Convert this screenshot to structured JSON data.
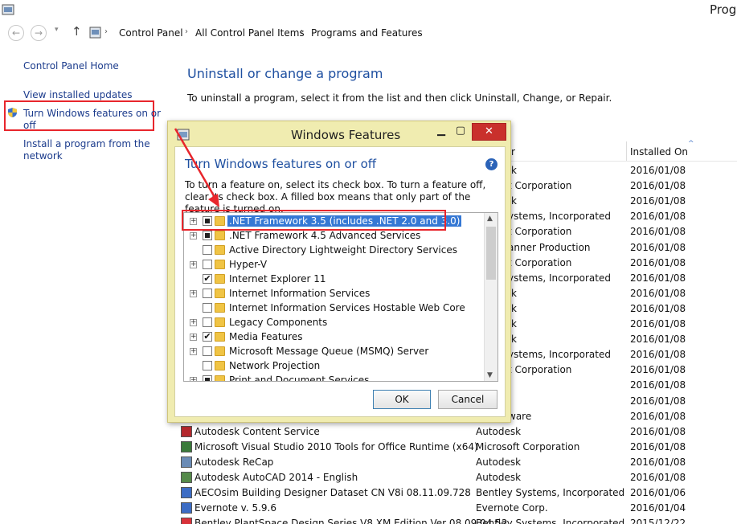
{
  "window": {
    "title": "Progr"
  },
  "address": {
    "crumbs": [
      "Control Panel",
      "All Control Panel Items",
      "Programs and Features"
    ]
  },
  "nav": {
    "back": "←",
    "forward": "→",
    "recent": "▾",
    "up": "↑",
    "sep": "›"
  },
  "sidebar": {
    "home": "Control Panel Home",
    "updates": "View installed updates",
    "features_line1": "Turn Windows features on or",
    "features_line2": "off",
    "install_line1": "Install a program from the",
    "install_line2": "network"
  },
  "main": {
    "title": "Uninstall or change a program",
    "description": "To uninstall a program, select it from the list and then click Uninstall, Change, or Repair.",
    "col_publisher_fragment": "r",
    "col_installed": "Installed On",
    "sort_glyph": "^"
  },
  "programs": [
    {
      "name": "",
      "publisher": "k",
      "date": "2016/01/08"
    },
    {
      "name": "",
      "publisher": "t Corporation",
      "date": "2016/01/08"
    },
    {
      "name": "",
      "publisher": "k",
      "date": "2016/01/08"
    },
    {
      "name": "",
      "publisher": "ystems, Incorporated",
      "date": "2016/01/08"
    },
    {
      "name": "",
      "publisher": "t Corporation",
      "date": "2016/01/08"
    },
    {
      "name": "",
      "publisher": "anner Production",
      "date": "2016/01/08"
    },
    {
      "name": "",
      "publisher": "t Corporation",
      "date": "2016/01/08"
    },
    {
      "name": "",
      "publisher": "ystems, Incorporated",
      "date": "2016/01/08"
    },
    {
      "name": "",
      "publisher": "k",
      "date": "2016/01/08"
    },
    {
      "name": "",
      "publisher": "k",
      "date": "2016/01/08"
    },
    {
      "name": "",
      "publisher": "k",
      "date": "2016/01/08"
    },
    {
      "name": "",
      "publisher": "k",
      "date": "2016/01/08"
    },
    {
      "name": "",
      "publisher": "ystems, Incorporated",
      "date": "2016/01/08"
    },
    {
      "name": "",
      "publisher": "t Corporation",
      "date": "2016/01/08"
    },
    {
      "name": "",
      "publisher": "",
      "date": "2016/01/08"
    },
    {
      "name": "",
      "publisher": "",
      "date": "2016/01/08"
    },
    {
      "name": "",
      "publisher": "ware",
      "date": "2016/01/08"
    },
    {
      "name": "Autodesk Content Service",
      "publisher": "Autodesk",
      "date": "2016/01/08"
    },
    {
      "name": "Microsoft Visual Studio 2010 Tools for Office Runtime (x64)",
      "publisher": "Microsoft Corporation",
      "date": "2016/01/08"
    },
    {
      "name": "Autodesk ReCap",
      "publisher": "Autodesk",
      "date": "2016/01/08"
    },
    {
      "name": "Autodesk AutoCAD 2014 - English",
      "publisher": "Autodesk",
      "date": "2016/01/08"
    },
    {
      "name": "AECOsim Building Designer Dataset CN V8i 08.11.09.728",
      "publisher": "Bentley Systems, Incorporated",
      "date": "2016/01/06"
    },
    {
      "name": "Evernote v. 5.9.6",
      "publisher": "Evernote Corp.",
      "date": "2016/01/04"
    },
    {
      "name": "Bentley PlantSpace Design Series V8 XM Edition Ver 08.09.04.52",
      "publisher": "Bentley Systems, Incorporated",
      "date": "2015/12/22"
    }
  ],
  "dialog": {
    "title": "Windows Features",
    "heading": "Turn Windows features on or off",
    "help": "?",
    "description": "To turn a feature on, select its check box. To turn a feature off, clear its check box. A filled box means that only part of the feature is turned on.",
    "minimize": "▁",
    "maximize": "▢",
    "close": "✕",
    "ok": "OK",
    "cancel": "Cancel",
    "features": [
      {
        "label": ".NET Framework 3.5 (includes .NET 2.0 and 3.0)",
        "expand": "+",
        "check": "partial",
        "selected": true
      },
      {
        "label": ".NET Framework 4.5 Advanced Services",
        "expand": "+",
        "check": "partial"
      },
      {
        "label": "Active Directory Lightweight Directory Services",
        "expand": "",
        "check": ""
      },
      {
        "label": "Hyper-V",
        "expand": "+",
        "check": ""
      },
      {
        "label": "Internet Explorer 11",
        "expand": "",
        "check": "✔"
      },
      {
        "label": "Internet Information Services",
        "expand": "+",
        "check": ""
      },
      {
        "label": "Internet Information Services Hostable Web Core",
        "expand": "",
        "check": ""
      },
      {
        "label": "Legacy Components",
        "expand": "+",
        "check": ""
      },
      {
        "label": "Media Features",
        "expand": "+",
        "check": "✔"
      },
      {
        "label": "Microsoft Message Queue (MSMQ) Server",
        "expand": "+",
        "check": ""
      },
      {
        "label": "Network Projection",
        "expand": "",
        "check": ""
      },
      {
        "label": "Print and Document Services",
        "expand": "+",
        "check": "partial"
      }
    ]
  },
  "colors": {
    "annotation": "#e8262c",
    "link": "#1b3b8c",
    "heading": "#1e4fa0",
    "dialog_frame": "#f0ecb0",
    "selection": "#3578d4"
  }
}
